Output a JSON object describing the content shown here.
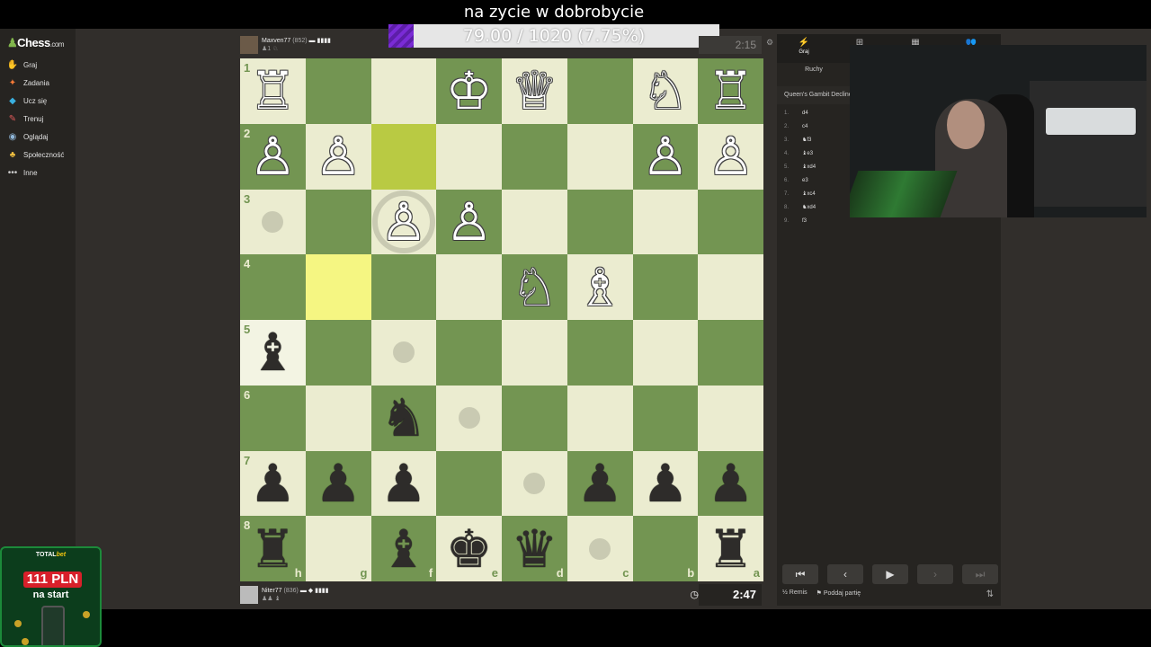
{
  "overlay": {
    "title": "na zycie w dobrobycie",
    "goal_text": "79.00 / 1020 (7.75%)",
    "goal_fraction": 0.0775
  },
  "sidebar": {
    "logo": "Chess",
    "logo_suffix": ".com",
    "items": [
      {
        "label": "Graj",
        "icon": "play-icon",
        "color": "#81b64c"
      },
      {
        "label": "Zadania",
        "icon": "puzzle-icon",
        "color": "#f77a37"
      },
      {
        "label": "Ucz się",
        "icon": "learn-icon",
        "color": "#3ab0e0"
      },
      {
        "label": "Trenuj",
        "icon": "train-icon",
        "color": "#e05a5a"
      },
      {
        "label": "Oglądaj",
        "icon": "watch-icon",
        "color": "#8fb6d8"
      },
      {
        "label": "Społeczność",
        "icon": "community-icon",
        "color": "#f0c040"
      },
      {
        "label": "Inne",
        "icon": "more-icon",
        "color": "#cccccc"
      }
    ]
  },
  "ad": {
    "brand": "TOTAL",
    "brand_accent": "bet",
    "amount": "111 PLN",
    "subtitle": "na start"
  },
  "top_player": {
    "name": "Maxven77",
    "rating": "(852)",
    "flags": "▬ ▮▮▮▮",
    "captured": "♟1 ♘",
    "clock": "2:15"
  },
  "bottom_player": {
    "name": "Niter77",
    "rating": "(836)",
    "flags": "▬ ◆ ▮▮▮▮",
    "captured": "♟♟ ♝",
    "clock": "2:47"
  },
  "board": {
    "orientation": "black",
    "ranks": [
      "1",
      "2",
      "3",
      "4",
      "5",
      "6",
      "7",
      "8"
    ],
    "files": [
      "h",
      "g",
      "f",
      "e",
      "d",
      "c",
      "b",
      "a"
    ],
    "light_color": "#ebecd0",
    "dark_color": "#739552",
    "highlight_color": "#f5f682",
    "rows": [
      [
        "wR",
        "",
        "",
        "wK",
        "wQ",
        "",
        "wN",
        "wR"
      ],
      [
        "wP",
        "wP",
        "",
        "",
        "",
        "",
        "wP",
        "wP"
      ],
      [
        "",
        "",
        "wP",
        "wP",
        "",
        "",
        "",
        ""
      ],
      [
        "",
        "",
        "",
        "",
        "wN",
        "wB",
        "",
        ""
      ],
      [
        "bB",
        "",
        "",
        "",
        "",
        "",
        "",
        ""
      ],
      [
        "",
        "",
        "bN",
        "",
        "",
        "",
        "",
        ""
      ],
      [
        "bP",
        "bP",
        "bP",
        "",
        "",
        "bP",
        "bP",
        "bP"
      ],
      [
        "bR",
        "",
        "bB",
        "bK",
        "bQ",
        "",
        "",
        "bR"
      ]
    ],
    "last_move": [
      [
        1,
        2
      ],
      [
        3,
        1
      ]
    ],
    "selected": [
      4,
      0
    ],
    "move_dots": [
      [
        2,
        0
      ],
      [
        4,
        2
      ],
      [
        5,
        3
      ],
      [
        6,
        4
      ],
      [
        7,
        5
      ]
    ],
    "capture_rings": [
      [
        2,
        2
      ]
    ]
  },
  "panel": {
    "tabs": [
      {
        "label": "Graj",
        "icon": "lightning-icon"
      },
      {
        "label": "N",
        "icon": "new-game-icon"
      },
      {
        "label": "",
        "icon": "board-icon"
      },
      {
        "label": "",
        "icon": "players-icon"
      }
    ],
    "subtab": "Ruchy",
    "opening": "Queen's Gambit Declined",
    "moves": [
      {
        "n": "1.",
        "w": "d4"
      },
      {
        "n": "2.",
        "w": "c4"
      },
      {
        "n": "3.",
        "w": "♞f3"
      },
      {
        "n": "4.",
        "w": "♝e3"
      },
      {
        "n": "5.",
        "w": "♝xd4"
      },
      {
        "n": "6.",
        "w": "e3"
      },
      {
        "n": "7.",
        "w": "♝xc4"
      },
      {
        "n": "8.",
        "w": "♞xd4"
      },
      {
        "n": "9.",
        "w": "f3"
      }
    ],
    "draw": "Remis",
    "resign": "Poddaj partię"
  }
}
